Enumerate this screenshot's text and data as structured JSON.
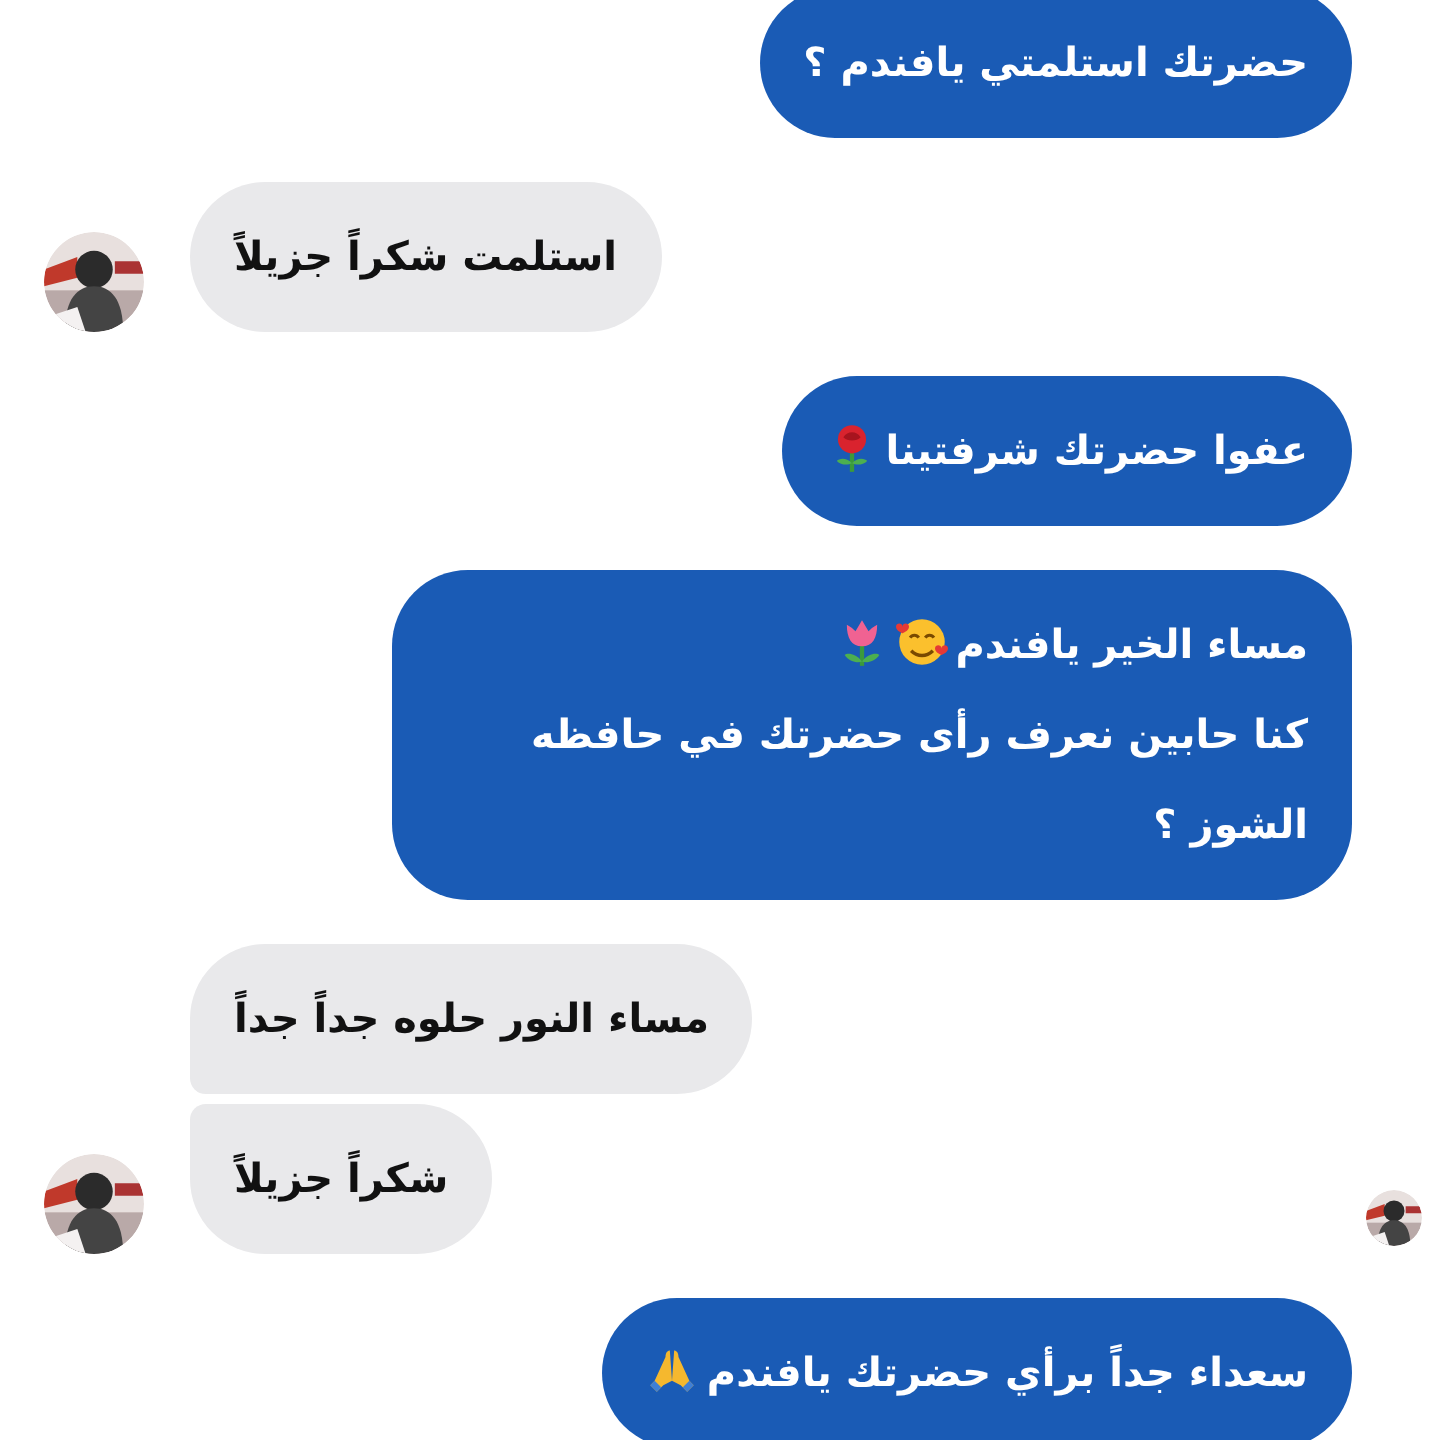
{
  "messages": [
    {
      "kind": "outgoing",
      "grouped_above": false,
      "grouped_below": false,
      "avatar": false,
      "seen_avatar": false,
      "lines": [
        {
          "text": "حضرتك استلمتي يافندم ؟"
        }
      ]
    },
    {
      "kind": "incoming",
      "grouped_above": false,
      "grouped_below": false,
      "avatar": true,
      "seen_avatar": false,
      "lines": [
        {
          "text": "استلمت شكراً جزيلاً"
        }
      ]
    },
    {
      "kind": "outgoing",
      "grouped_above": false,
      "grouped_below": false,
      "avatar": false,
      "seen_avatar": false,
      "lines": [
        {
          "text": "عفوا حضرتك شرفتينا",
          "emoji": [
            {
              "kind": "rose"
            }
          ]
        }
      ]
    },
    {
      "kind": "outgoing",
      "grouped_above": false,
      "grouped_below": false,
      "avatar": false,
      "seen_avatar": false,
      "lines": [
        {
          "text": "مساء الخير يافندم",
          "emoji": [
            {
              "kind": "smiley"
            },
            {
              "kind": "tulip"
            }
          ]
        },
        {
          "text": "كنا حابين نعرف رأى حضرتك في حافظه الشوز  ؟"
        }
      ]
    },
    {
      "kind": "incoming",
      "grouped_above": false,
      "grouped_below": true,
      "avatar": false,
      "seen_avatar": false,
      "lines": [
        {
          "text": "مساء النور حلوه جداً جداً"
        }
      ]
    },
    {
      "kind": "incoming",
      "grouped_above": true,
      "grouped_below": false,
      "avatar": true,
      "seen_avatar": true,
      "lines": [
        {
          "text": "شكراً جزيلاً"
        }
      ]
    },
    {
      "kind": "outgoing",
      "grouped_above": false,
      "grouped_below": false,
      "avatar": false,
      "seen_avatar": false,
      "lines": [
        {
          "text": "سعداء جداً برأي حضرتك يافندم",
          "emoji": [
            {
              "kind": "prayer"
            }
          ]
        }
      ]
    }
  ]
}
